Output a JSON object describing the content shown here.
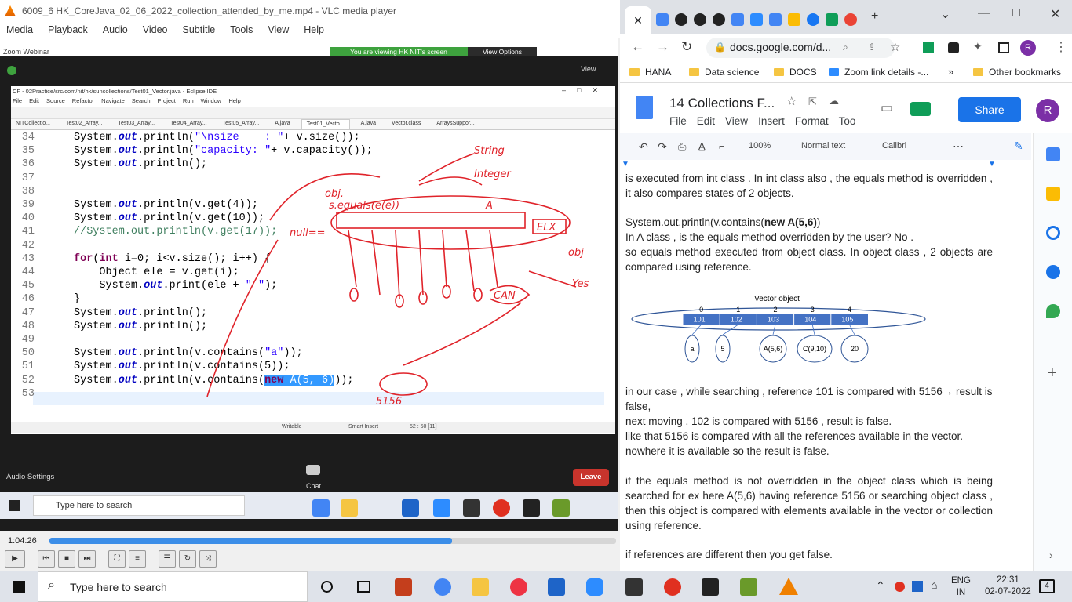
{
  "vlc": {
    "title": "6009_6 HK_CoreJava_02_06_2022_collection_attended_by_me.mp4 - VLC media player",
    "menu": [
      "Media",
      "Playback",
      "Audio",
      "Video",
      "Subtitle",
      "Tools",
      "View",
      "Help"
    ],
    "time_elapsed": "1:04:26",
    "progress_fraction": 0.71
  },
  "zoom": {
    "window_label": "Zoom Webinar",
    "banner": "You are viewing HK NIT's screen",
    "view_options": "View Options",
    "view": "View",
    "audio_settings": "Audio Settings",
    "chat": "Chat",
    "leave": "Leave",
    "inner_search": "Type here to search"
  },
  "eclipse": {
    "title": "CF - 02Practice/src/com/nit/hk/suncollections/Test01_Vector.java - Eclipse IDE",
    "menu": [
      "File",
      "Edit",
      "Source",
      "Refactor",
      "Navigate",
      "Search",
      "Project",
      "Run",
      "Window",
      "Help"
    ],
    "tabs": [
      "NITCollectio...",
      "Test02_Array...",
      "Test03_Array...",
      "Test04_Array...",
      "Test05_Array...",
      "A.java",
      "Test01_Vecto...",
      "A.java",
      "Vector.class",
      "ArraysSuppor..."
    ],
    "active_tab": 6,
    "status_writable": "Writable",
    "status_insert": "Smart Insert",
    "status_pos": "52 : 50 [11]",
    "lines": [
      {
        "n": "34",
        "c": "System.out.println(\"\\nsize    : \"+ v.size());"
      },
      {
        "n": "35",
        "c": "System.out.println(\"capacity: \"+ v.capacity());"
      },
      {
        "n": "36",
        "c": "System.out.println();"
      },
      {
        "n": "37",
        "c": ""
      },
      {
        "n": "38",
        "c": ""
      },
      {
        "n": "39",
        "c": "System.out.println(v.get(4));"
      },
      {
        "n": "40",
        "c": "System.out.println(v.get(10));"
      },
      {
        "n": "41",
        "c": "//System.out.println(v.get(17));"
      },
      {
        "n": "42",
        "c": ""
      },
      {
        "n": "43",
        "c": "for(int i=0; i<v.size(); i++) {"
      },
      {
        "n": "44",
        "c": "    Object ele = v.get(i);"
      },
      {
        "n": "45",
        "c": "    System.out.print(ele + \" \");"
      },
      {
        "n": "46",
        "c": "}"
      },
      {
        "n": "47",
        "c": "System.out.println();"
      },
      {
        "n": "48",
        "c": "System.out.println();"
      },
      {
        "n": "49",
        "c": ""
      },
      {
        "n": "50",
        "c": "System.out.println(v.contains(\"a\"));"
      },
      {
        "n": "51",
        "c": "System.out.println(v.contains(5));"
      },
      {
        "n": "52",
        "c": "System.out.println(v.contains(new A(5, 6)));"
      },
      {
        "n": "53",
        "c": ""
      }
    ],
    "annotations": [
      "String",
      "Integer",
      "A",
      "ELX",
      "obj",
      "Yes",
      "null==",
      "obj.",
      "s.equals(e(e))",
      "CAN",
      "5156"
    ]
  },
  "chrome": {
    "omnibox": "docs.google.com/d...",
    "bookmarks": [
      "HANA",
      "Data science",
      "DOCS",
      "Zoom link details -...",
      "Other bookmarks"
    ],
    "overflow": "»"
  },
  "docs": {
    "title": "14 Collections F...",
    "menu": [
      "File",
      "Edit",
      "View",
      "Insert",
      "Format",
      "Too"
    ],
    "share": "Share",
    "avatar": "R",
    "zoom": "100%",
    "style": "Normal text",
    "font": "Calibri",
    "para1": "is executed from int class .  In int class also , the equals method is overridden , it also compares states of 2 objects.",
    "code_prefix": "System.out.println(v.contains(",
    "code_bold": "new A(5,6)",
    "code_suffix": ")",
    "para2": "In A class , is the equals method overridden by the user? No .",
    "para3": "so equals method executed from object class. In object class , 2 objects are compared using reference.",
    "diagram": {
      "title": "Vector object",
      "indices": [
        "0",
        "1",
        "2",
        "3",
        "4"
      ],
      "refs": [
        "101",
        "102",
        "103",
        "104",
        "105"
      ],
      "elements": [
        "a",
        "5",
        "A(5,6)",
        "C(9,10)",
        "20"
      ]
    },
    "para4": "in our case , while searching , reference 101 is compared with 5156→ result is false,",
    "para5": "next moving , 102 is compared with 5156 , result is false.",
    "para6": "like that 5156 is compared with all the references available in the vector.",
    "para7": "nowhere it is available so the result is false.",
    "para8": " if the equals method is not overridden in the object class which is being searched for ex here A(5,6) having reference 5156 or searching object class , then this object is compared with elements available in the vector or collection using reference.",
    "para9": "if references are different then you get false."
  },
  "taskbar": {
    "search": "Type here to search",
    "lang1": "ENG",
    "lang2": "IN",
    "time": "22:31",
    "date": "02-07-2022",
    "notifications": "4"
  }
}
